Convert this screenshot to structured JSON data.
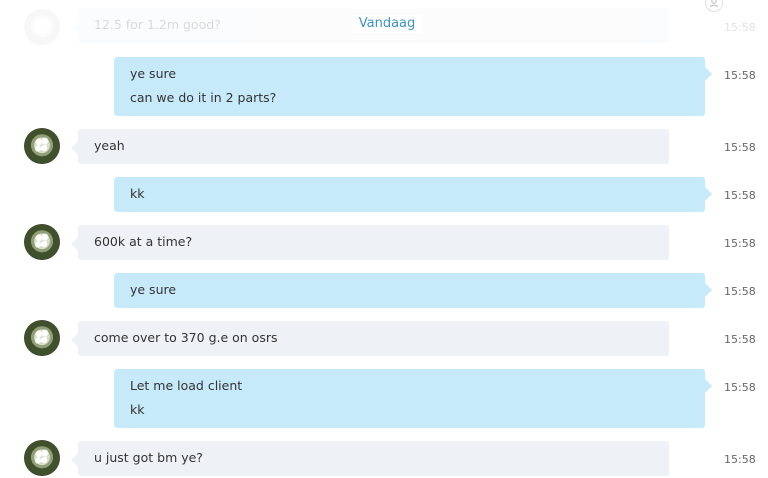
{
  "separator": {
    "label": "Vandaag"
  },
  "messages": [
    {
      "direction": "incoming",
      "lines": [
        "12.5 for 1.2m good?"
      ],
      "time": "15:58",
      "faded": true
    },
    {
      "direction": "outgoing",
      "lines": [
        "ye sure",
        "can we do it in 2 parts?"
      ],
      "time": "15:58"
    },
    {
      "direction": "incoming",
      "lines": [
        "yeah"
      ],
      "time": "15:58"
    },
    {
      "direction": "outgoing",
      "lines": [
        "kk"
      ],
      "time": "15:58"
    },
    {
      "direction": "incoming",
      "lines": [
        "600k at a time?"
      ],
      "time": "15:58"
    },
    {
      "direction": "outgoing",
      "lines": [
        "ye sure"
      ],
      "time": "15:58"
    },
    {
      "direction": "incoming",
      "lines": [
        "come over to 370 g.e on osrs"
      ],
      "time": "15:58"
    },
    {
      "direction": "outgoing",
      "lines": [
        "Let me load client",
        "kk"
      ],
      "time": "15:58"
    },
    {
      "direction": "incoming",
      "lines": [
        "u just got bm ye?"
      ],
      "time": "15:58"
    }
  ],
  "icons": {
    "avatar": "contact-avatar",
    "status": "user-status-icon"
  }
}
